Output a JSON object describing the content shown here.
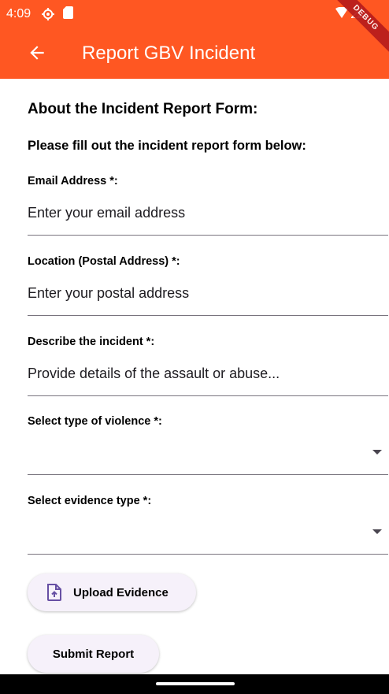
{
  "status_bar": {
    "time": "4:09",
    "icons": [
      "settings-icon",
      "sd-card-icon",
      "wifi-icon",
      "cell-signal-icon"
    ]
  },
  "debug_banner": "DEBUG",
  "app_bar": {
    "title": "Report GBV Incident",
    "back_icon": "arrow-back-icon",
    "color": "#ff5722"
  },
  "form": {
    "about_title": "About the Incident Report Form:",
    "instructions": "Please fill out the incident report form below:",
    "email": {
      "label": "Email Address *:",
      "placeholder": "Enter your email address",
      "value": ""
    },
    "location": {
      "label": "Location (Postal Address) *:",
      "placeholder": "Enter your postal address",
      "value": ""
    },
    "description": {
      "label": "Describe the incident *:",
      "placeholder": "Provide details of the assault or abuse...",
      "value": ""
    },
    "violence_type": {
      "label": "Select type of violence *:",
      "selected": ""
    },
    "evidence_type": {
      "label": "Select evidence type *:",
      "selected": ""
    },
    "upload_button": "Upload Evidence",
    "submit_button": "Submit Report"
  },
  "colors": {
    "accent": "#ff5722",
    "button_bg": "#f6f1fa",
    "icon_purple": "#6750a4"
  }
}
